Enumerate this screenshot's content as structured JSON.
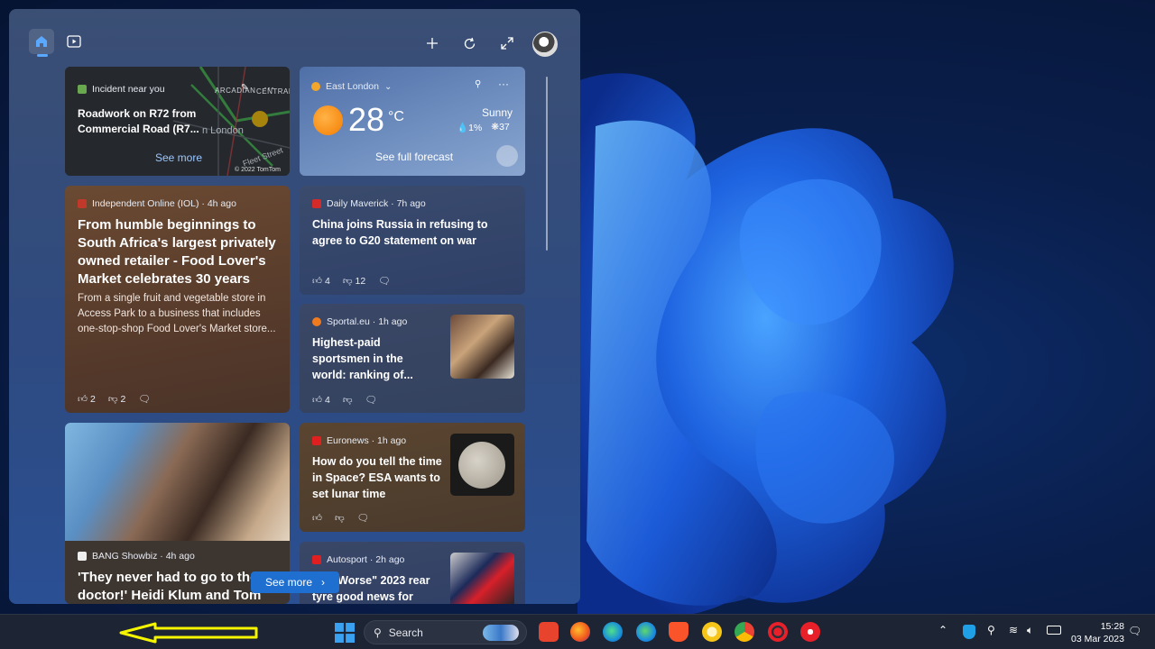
{
  "header": {
    "home_icon": "home-icon",
    "video_icon": "video-icon",
    "add_icon": "plus-icon",
    "refresh_icon": "refresh-icon",
    "expand_icon": "expand-icon"
  },
  "traffic": {
    "source": "Incident near you",
    "title": "Roadwork on R72 from Commercial Road (R7...",
    "see_more": "See more",
    "map_labels": [
      "ARCADIAN",
      "CENTRAL",
      "n London",
      "Fleet Street"
    ],
    "copyright": "© 2022 TomTom"
  },
  "weather": {
    "location": "East London",
    "temperature": "28",
    "unit": "°C",
    "condition": "Sunny",
    "precip": "1%",
    "aqi": "37",
    "forecast_link": "See full forecast"
  },
  "news": [
    {
      "source": "Independent Online (IOL) · 4h ago",
      "title": "From humble beginnings to South Africa's largest privately owned retailer - Food Lover's Market celebrates 30 years",
      "summary": "From a single fruit and vegetable store in Access Park to a business that includes one-stop-shop Food Lover's Market store...",
      "likes": "2",
      "dislikes": "2"
    },
    {
      "source": "Daily Maverick · 7h ago",
      "title": "China joins Russia in refusing to agree to G20 statement on war",
      "likes": "4",
      "dislikes": "12"
    },
    {
      "source": "Sportal.eu · 1h ago",
      "title": "Highest-paid sportsmen in the world: ranking of...",
      "likes": "4"
    },
    {
      "source": "BANG Showbiz · 4h ago",
      "title": "'They never had to go to the doctor!' Heidi Klum and Tom"
    },
    {
      "source": "Euronews · 1h ago",
      "title": "How do you tell the time in Space? ESA wants to set lunar time"
    },
    {
      "source": "Autosport · 2h ago",
      "title": "F1: \"Worse\" 2023 rear tyre good news for"
    }
  ],
  "see_more_button": "See more",
  "taskbar": {
    "search_label": "Search",
    "time": "15:28",
    "date": "03 Mar 2023"
  },
  "colors": {
    "accent": "#5aa9ff",
    "see_more_button": "#1f6fd1",
    "annotation_arrow": "#f5f500"
  }
}
